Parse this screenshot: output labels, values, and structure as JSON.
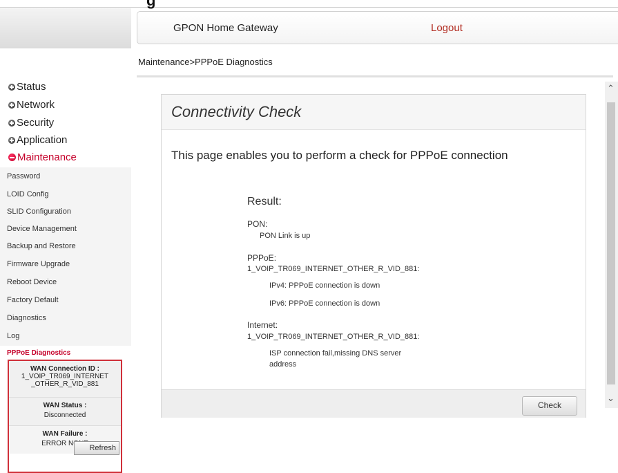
{
  "top_cutoff_text": "g",
  "header": {
    "title": "GPON Home Gateway",
    "logout": "Logout"
  },
  "breadcrumb": "Maintenance>PPPoE Diagnostics",
  "sidebar": {
    "menus": [
      {
        "label": "Status"
      },
      {
        "label": "Network"
      },
      {
        "label": "Security"
      },
      {
        "label": "Application"
      },
      {
        "label": "Maintenance"
      }
    ],
    "items": [
      {
        "label": "Password"
      },
      {
        "label": "LOID Config"
      },
      {
        "label": "SLID Configuration"
      },
      {
        "label": "Device Management"
      },
      {
        "label": "Backup and Restore"
      },
      {
        "label": "Firmware Upgrade"
      },
      {
        "label": "Reboot Device"
      },
      {
        "label": "Factory Default"
      },
      {
        "label": "Diagnostics"
      },
      {
        "label": "Log"
      },
      {
        "label": "PPPoE Diagnostics"
      }
    ]
  },
  "wan": {
    "conn_id_label": "WAN Connection ID :",
    "conn_id_line1": "1_VOIP_TR069_INTERNET",
    "conn_id_line2": "_OTHER_R_VID_881",
    "status_label": "WAN Status :",
    "status_value": "Disconnected",
    "failure_label": "WAN Failure :",
    "failure_value": "ERROR NONE",
    "refresh": "Refresh"
  },
  "panel": {
    "title": "Connectivity Check",
    "description": "This page enables you to perform a check for PPPoE connection",
    "result_label": "Result:",
    "pon_label": "PON:",
    "pon_status": "PON Link is up",
    "pppoe_label": "PPPoE:",
    "pppoe_conn": "1_VOIP_TR069_INTERNET_OTHER_R_VID_881:",
    "ipv4": "IPv4: PPPoE connection is down",
    "ipv6": "IPv6: PPPoE connection is down",
    "internet_label": "Internet:",
    "internet_conn": "1_VOIP_TR069_INTERNET_OTHER_R_VID_881:",
    "isp_line1": "ISP connection fail,missing DNS server",
    "isp_line2": "address",
    "check": "Check"
  }
}
